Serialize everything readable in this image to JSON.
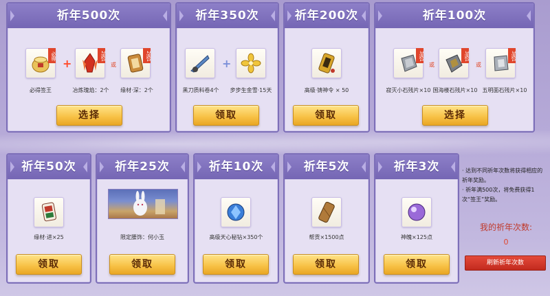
{
  "cards": {
    "c500": {
      "title": "祈年500次",
      "items": [
        {
          "caption": "必得签王",
          "badge": "必得",
          "icon": "gold-pot-icon"
        },
        {
          "caption": "冶炼瑰焰：2个",
          "badge": "2选1",
          "icon": "red-crystal-icon"
        },
        {
          "caption": "缘材·深：2个",
          "badge": "2选1",
          "icon": "scroll-token-icon"
        }
      ],
      "or_text": "或",
      "button": "选择"
    },
    "c350": {
      "title": "祈年350次",
      "items": [
        {
          "caption": "黑刀质料卷4个",
          "icon": "blade-feather-icon"
        },
        {
          "caption": "步步生金雪·15天",
          "icon": "golden-flower-icon"
        }
      ],
      "button": "领取"
    },
    "c200": {
      "title": "祈年200次",
      "items": [
        {
          "caption": "高级·铸神令 × 50",
          "icon": "golden-token-icon"
        }
      ],
      "button": "领取"
    },
    "c100": {
      "title": "祈年100次",
      "items": [
        {
          "caption": "寂灭小石残片×10",
          "badge": "3选1",
          "icon": "grey-stone-icon"
        },
        {
          "caption": "国海楼石残片×10",
          "badge": "3选1",
          "icon": "dark-stone-icon"
        },
        {
          "caption": "五明面石残片×10",
          "badge": "3选1",
          "icon": "silver-stone-icon"
        }
      ],
      "or_text": "或",
      "button": "选择"
    },
    "c50": {
      "title": "祈年50次",
      "items": [
        {
          "caption": "缘材·进×25",
          "icon": "mahjong-tile-icon"
        }
      ],
      "button": "领取"
    },
    "c25": {
      "title": "祈年25次",
      "items": [
        {
          "caption": "限定腰饰：何小玉",
          "icon": "rabbit-scene-image"
        }
      ],
      "button": "领取"
    },
    "c10": {
      "title": "祈年10次",
      "items": [
        {
          "caption": "高级天心秘钻×350个",
          "icon": "blue-gem-icon"
        }
      ],
      "button": "领取"
    },
    "c5": {
      "title": "祈年5次",
      "items": [
        {
          "caption": "帮贡×1500点",
          "icon": "wooden-plank-icon"
        }
      ],
      "button": "领取"
    },
    "c3": {
      "title": "祈年3次",
      "items": [
        {
          "caption": "神魄×125点",
          "icon": "purple-orb-icon"
        }
      ],
      "button": "领取"
    }
  },
  "side": {
    "notes": [
      "达到不同祈年次数将获得相应的祈年奖励。",
      "祈年满500次，将免费获得1次“签王”奖励。"
    ],
    "count_label": "我的祈年次数:",
    "count_value": "0",
    "refresh_button": "刷新祈年次数"
  },
  "colors": {
    "accent": "#7566b4",
    "button": "#f7c044",
    "badge": "#e0462c",
    "refresh": "#c22a1e"
  }
}
